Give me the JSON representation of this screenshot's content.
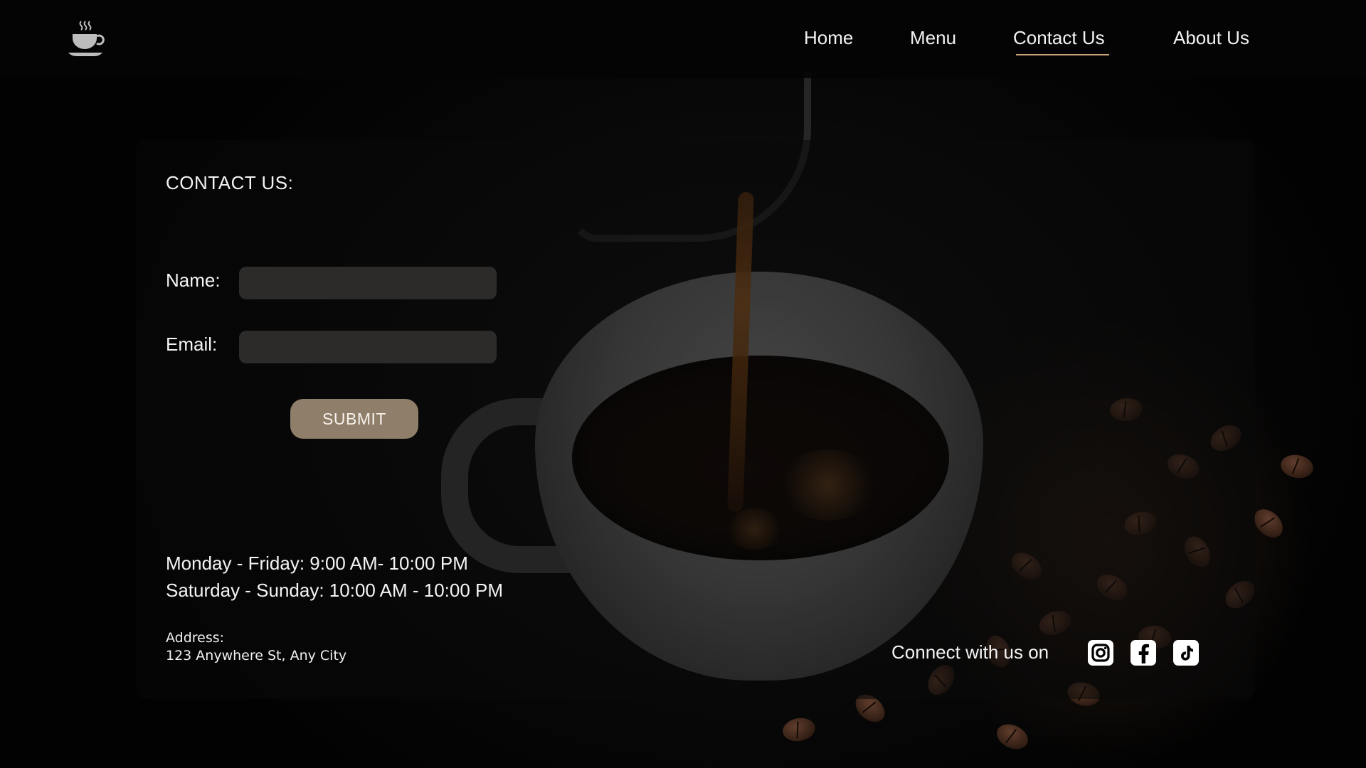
{
  "nav": {
    "items": [
      {
        "label": "Home"
      },
      {
        "label": "Menu"
      },
      {
        "label": "Contact Us",
        "active": true
      },
      {
        "label": "About Us"
      }
    ],
    "active_underline_color": "#c9a27a"
  },
  "logo": {
    "icon": "coffee-cup-icon"
  },
  "contact": {
    "title": "CONTACT US:",
    "name_label": "Name:",
    "name_value": "",
    "email_label": "Email:",
    "email_value": "",
    "submit_label": "SUBMIT",
    "submit_color": "#8f7e69",
    "hours_weekday": "Monday - Friday: 9:00 AM- 10:00 PM",
    "hours_weekend": "Saturday - Sunday: 10:00 AM - 10:00 PM",
    "address_label": "Address:",
    "address_value": "123 Anywhere St, Any City",
    "connect_text": "Connect with us on",
    "socials": [
      {
        "icon": "instagram-icon"
      },
      {
        "icon": "facebook-icon"
      },
      {
        "icon": "tiktok-icon"
      }
    ]
  }
}
